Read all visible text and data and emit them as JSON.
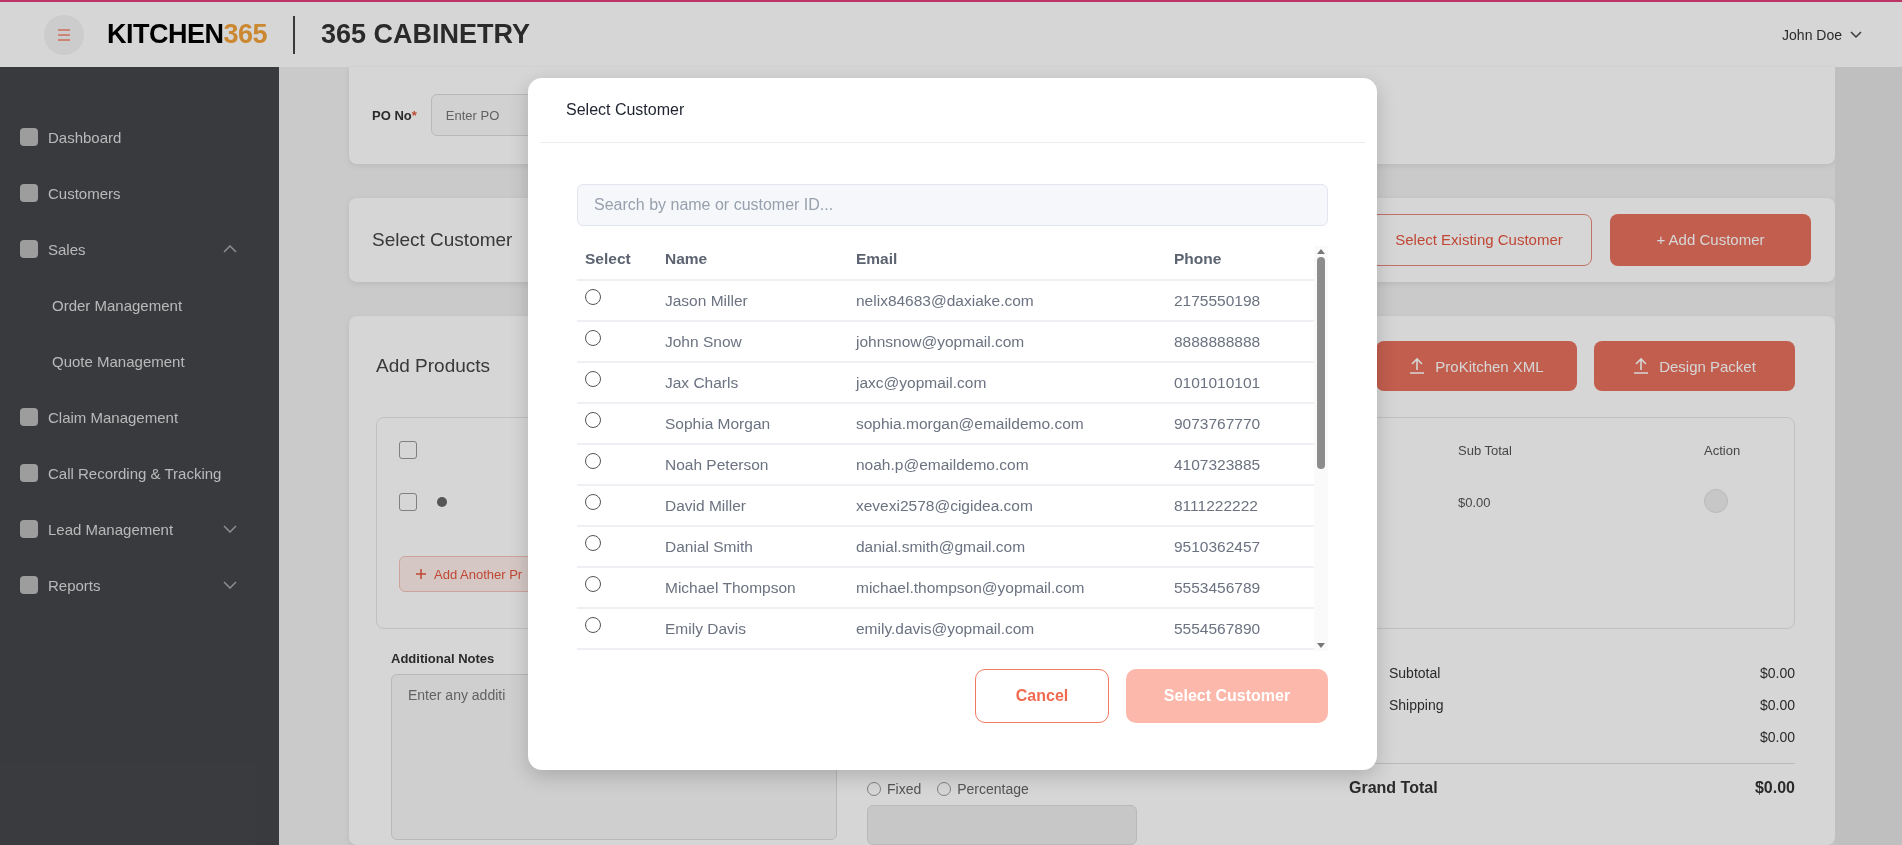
{
  "header": {
    "logo_main": "KITCHEN",
    "logo_accent": "365",
    "company": "365 CABINETRY",
    "user": "John Doe"
  },
  "sidebar": {
    "items": [
      {
        "label": "Dashboard"
      },
      {
        "label": "Customers"
      },
      {
        "label": "Sales",
        "expanded": true,
        "children": [
          {
            "label": "Order Management"
          },
          {
            "label": "Quote Management"
          }
        ]
      },
      {
        "label": "Claim Management"
      },
      {
        "label": "Call Recording & Tracking"
      },
      {
        "label": "Lead Management",
        "expanded": false
      },
      {
        "label": "Reports",
        "expanded": false
      }
    ]
  },
  "po_card": {
    "label": "PO No",
    "required_mark": "*",
    "placeholder": "Enter PO"
  },
  "customer_card": {
    "title": "Select Customer",
    "buttons": [
      {
        "label": "Select Existing Customer",
        "kind": "outline"
      },
      {
        "label": "+ Add Customer",
        "kind": "filled"
      }
    ]
  },
  "products_card": {
    "title": "Add Products",
    "buttons": [
      "ProKitchen XML",
      "Design Packet"
    ],
    "table": {
      "columns": [
        "Sub Total",
        "Action"
      ],
      "header_checked": false,
      "row": {
        "checked": false,
        "sub_total": "$0.00"
      }
    },
    "add_button": "Add Another Pr",
    "notes_label": "Additional Notes",
    "notes_placeholder": "Enter any additi",
    "discount_types": [
      {
        "label": "Fixed",
        "selected": false
      },
      {
        "label": "Percentage",
        "selected": false
      }
    ],
    "summary": [
      {
        "label": "Subtotal",
        "value": "$0.00"
      },
      {
        "label": "Shipping",
        "value": "$0.00"
      },
      {
        "value": "$0.00"
      }
    ],
    "grand_total": {
      "label": "Grand Total",
      "value": "$0.00"
    }
  },
  "modal": {
    "title": "Select Customer",
    "search": {
      "placeholder": "Search by name or customer ID..."
    },
    "columns": [
      "Select",
      "Name",
      "Email",
      "Phone"
    ],
    "rows": [
      {
        "name": "Jason Miller",
        "email": "nelix84683@daxiake.com",
        "phone": "2175550198",
        "selected": false
      },
      {
        "name": "John Snow",
        "email": "johnsnow@yopmail.com",
        "phone": "8888888888",
        "selected": false
      },
      {
        "name": "Jax Charls",
        "email": "jaxc@yopmail.com",
        "phone": "0101010101",
        "selected": false
      },
      {
        "name": "Sophia Morgan",
        "email": "sophia.morgan@emaildemo.com",
        "phone": "9073767770",
        "selected": false
      },
      {
        "name": "Noah Peterson",
        "email": "noah.p@emaildemo.com",
        "phone": "4107323885",
        "selected": false
      },
      {
        "name": "David Miller",
        "email": "xevexi2578@cigidea.com",
        "phone": "8111222222",
        "selected": false
      },
      {
        "name": "Danial Smith",
        "email": "danial.smith@gmail.com",
        "phone": "9510362457",
        "selected": false
      },
      {
        "name": "Michael Thompson",
        "email": "michael.thompson@yopmail.com",
        "phone": "5553456789",
        "selected": false
      },
      {
        "name": "Emily Davis",
        "email": "emily.davis@yopmail.com",
        "phone": "5554567890",
        "selected": false
      }
    ],
    "cancel": "Cancel",
    "confirm": {
      "label": "Select Customer",
      "disabled": true
    }
  }
}
